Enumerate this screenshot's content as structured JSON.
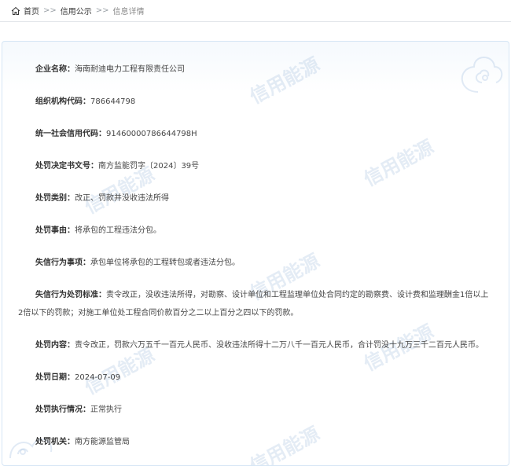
{
  "breadcrumb": {
    "home": "首页",
    "sep1": ">>",
    "section": "信用公示",
    "sep2": ">>",
    "current": "信息详情"
  },
  "watermark": "信用能源",
  "fields": [
    {
      "label": "企业名称：",
      "value": "海南耐迪电力工程有限责任公司"
    },
    {
      "label": "组织机构代码：",
      "value": "786644798"
    },
    {
      "label": "统一社会信用代码：",
      "value": "91460000786644798H"
    },
    {
      "label": "处罚决定书文号：",
      "value": "南方监能罚字〔2024〕39号"
    },
    {
      "label": "处罚类别：",
      "value": "改正、罚款并没收违法所得"
    },
    {
      "label": "处罚事由：",
      "value": "将承包的工程违法分包。"
    },
    {
      "label": "失信行为事项：",
      "value": "承包单位将承包的工程转包或者违法分包。"
    },
    {
      "label": "失信行为处罚标准：",
      "value": "责令改正，没收违法所得，对勘察、设计单位和工程监理单位处合同约定的勘察费、设计费和监理酬金1倍以上2倍以下的罚款；对施工单位处工程合同价款百分之二以上百分之四以下的罚款。"
    },
    {
      "label": "处罚内容：",
      "value": "责令改正，罚款六万五千一百元人民币、没收违法所得十二万八千一百元人民币，合计罚没十九万三千二百元人民币。"
    },
    {
      "label": "处罚日期：",
      "value": "2024-07-09"
    },
    {
      "label": "处罚执行情况：",
      "value": "正常执行"
    },
    {
      "label": "处罚机关：",
      "value": "南方能源监管局"
    }
  ]
}
